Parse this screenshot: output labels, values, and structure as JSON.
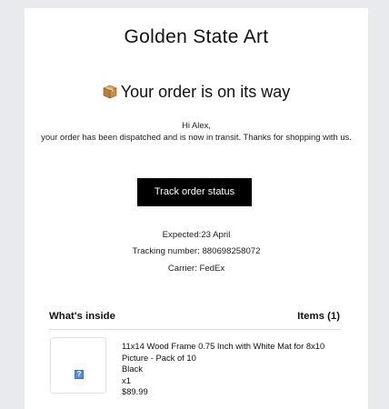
{
  "brand": {
    "name": "Golden State Art"
  },
  "header": {
    "icon": "package-icon",
    "title": "Your order is on its way"
  },
  "message": {
    "greeting": "Hi Alex,",
    "body": "your order has been dispatched and is now in transit. Thanks for shopping with us."
  },
  "cta": {
    "label": "Track order status"
  },
  "shipping": {
    "expected": "Expected:23 April",
    "tracking": "Tracking number: 880698258072",
    "carrier": "Carrier: FedEx"
  },
  "items_section": {
    "title": "What's inside",
    "count_label": "Items (1)"
  },
  "items": [
    {
      "image_icon": "broken-image-icon",
      "name": "11x14 Wood Frame 0.75 Inch with White Mat for 8x10 Picture - Pack of 10",
      "variant": "Black",
      "quantity": "x1",
      "price": "$89.99"
    }
  ],
  "colors": {
    "page_background": "#e9eaee",
    "card_background": "#ffffff",
    "button_background": "#000000",
    "button_text": "#ffffff"
  }
}
